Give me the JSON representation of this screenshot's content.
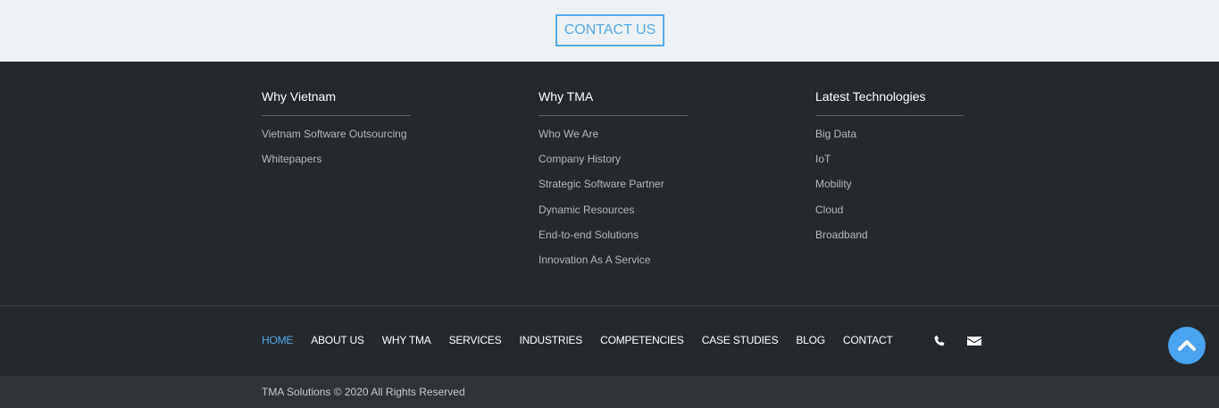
{
  "top": {
    "contact_button": "CONTACT US"
  },
  "columns": [
    {
      "title": "Why Vietnam",
      "items": [
        "Vietnam Software Outsourcing",
        "Whitepapers"
      ]
    },
    {
      "title": "Why TMA",
      "items": [
        "Who We Are",
        "Company History",
        "Strategic Software Partner",
        "Dynamic Resources",
        "End-to-end Solutions",
        "Innovation As A Service"
      ]
    },
    {
      "title": "Latest Technologies",
      "items": [
        "Big Data",
        "IoT",
        "Mobility",
        "Cloud",
        "Broadband"
      ]
    }
  ],
  "nav": {
    "items": [
      "HOME",
      "ABOUT US",
      "WHY TMA",
      "SERVICES",
      "INDUSTRIES",
      "COMPETENCIES",
      "CASE STUDIES",
      "BLOG",
      "CONTACT"
    ],
    "active": "HOME",
    "icons": [
      "phone-icon",
      "mail-icon"
    ]
  },
  "copyright": "TMA Solutions © 2020 All Rights Reserved",
  "colors": {
    "accent": "#56a9e8",
    "footer_bg": "#24292d",
    "top_bg": "#edf1f6"
  }
}
